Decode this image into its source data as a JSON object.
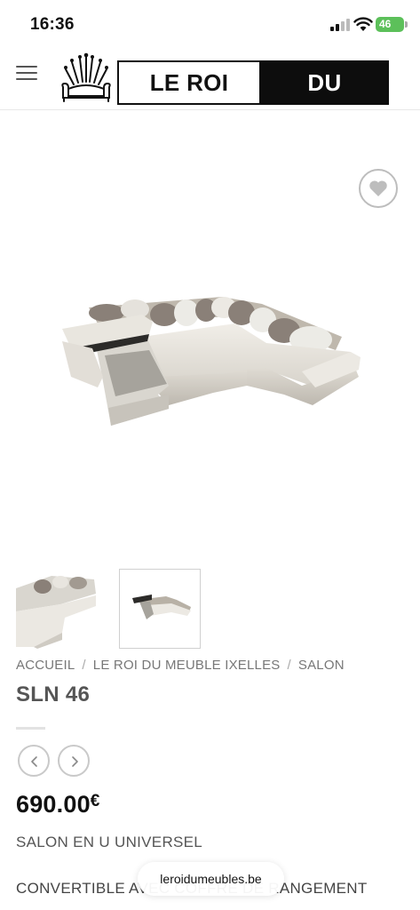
{
  "status_bar": {
    "time": "16:36",
    "battery_label": "46"
  },
  "header": {
    "menu_icon": "hamburger-menu-icon",
    "logo_left": "LE ROI",
    "logo_right": "DU MEUBLE",
    "colors": {
      "logo_black": "#0d0d0d"
    }
  },
  "gallery": {
    "wishlist_icon": "heart-icon",
    "thumbnail_count": 2,
    "selected_thumbnail": 2
  },
  "breadcrumb": {
    "items": [
      "ACCUEIL",
      "LE ROI DU MEUBLE IXELLES",
      "SALON"
    ],
    "separator": "/"
  },
  "product": {
    "title": "SLN 46",
    "price": "690.00",
    "currency": "€",
    "subtitle": "SALON EN U UNIVERSEL",
    "description_line": "CONVERTIBLE AVEC COFFRE DE RANGEMENT"
  },
  "browser": {
    "url": "leroidumeubles.be"
  }
}
